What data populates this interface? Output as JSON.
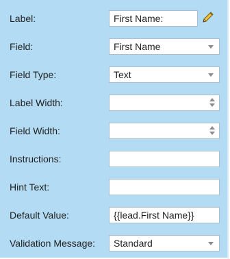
{
  "form": {
    "label": {
      "label": "Label:",
      "value": "First Name:"
    },
    "field": {
      "label": "Field:",
      "value": "First Name"
    },
    "field_type": {
      "label": "Field Type:",
      "value": "Text"
    },
    "label_width": {
      "label": "Label Width:",
      "value": ""
    },
    "field_width": {
      "label": "Field Width:",
      "value": ""
    },
    "instructions": {
      "label": "Instructions:",
      "value": ""
    },
    "hint_text": {
      "label": "Hint Text:",
      "value": ""
    },
    "default_value": {
      "label": "Default Value:",
      "value": "{{lead.First Name}}"
    },
    "validation_message": {
      "label": "Validation Message:",
      "value": "Standard"
    }
  },
  "icons": {
    "edit": "pencil-icon",
    "dropdown": "chevron-down-icon",
    "spinner": "stepper-arrows-icon"
  },
  "colors": {
    "panel_background": "#b3dbf3",
    "input_background": "#ffffff",
    "input_border": "#a8bfd0",
    "pencil_body": "#f2c53d",
    "text": "#1f1f1f"
  }
}
